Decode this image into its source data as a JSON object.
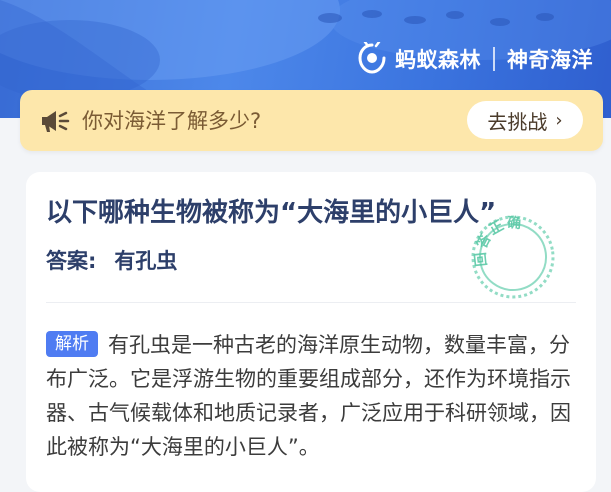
{
  "brand": {
    "logo_icon": "ant-logo-icon",
    "name": "蚂蚁森林",
    "section": "神奇海洋"
  },
  "banner": {
    "icon": "megaphone-icon",
    "text": "你对海洋了解多少?",
    "button_label": "去挑战",
    "button_icon": "chevron-right-icon"
  },
  "question": {
    "title": "以下哪种生物被称为“大海里的小巨人”",
    "answer_label": "答案:",
    "answer_value": "有孔虫",
    "stamp_text": "回答正确"
  },
  "analysis": {
    "tag": "解析",
    "text": "有孔虫是一种古老的海洋原生动物，数量丰富，分布广泛。它是浮游生物的重要组成部分，还作为环境指示器、古气候载体和地质记录者，广泛应用于科研领域，因此被称为“大海里的小巨人”。"
  },
  "colors": {
    "hero_blue": "#4d88ea",
    "banner_bg": "#fde7ab",
    "title_text": "#2d3f6a",
    "tag_blue": "#4f7cf2",
    "stamp_green": "#5cc9a7"
  }
}
